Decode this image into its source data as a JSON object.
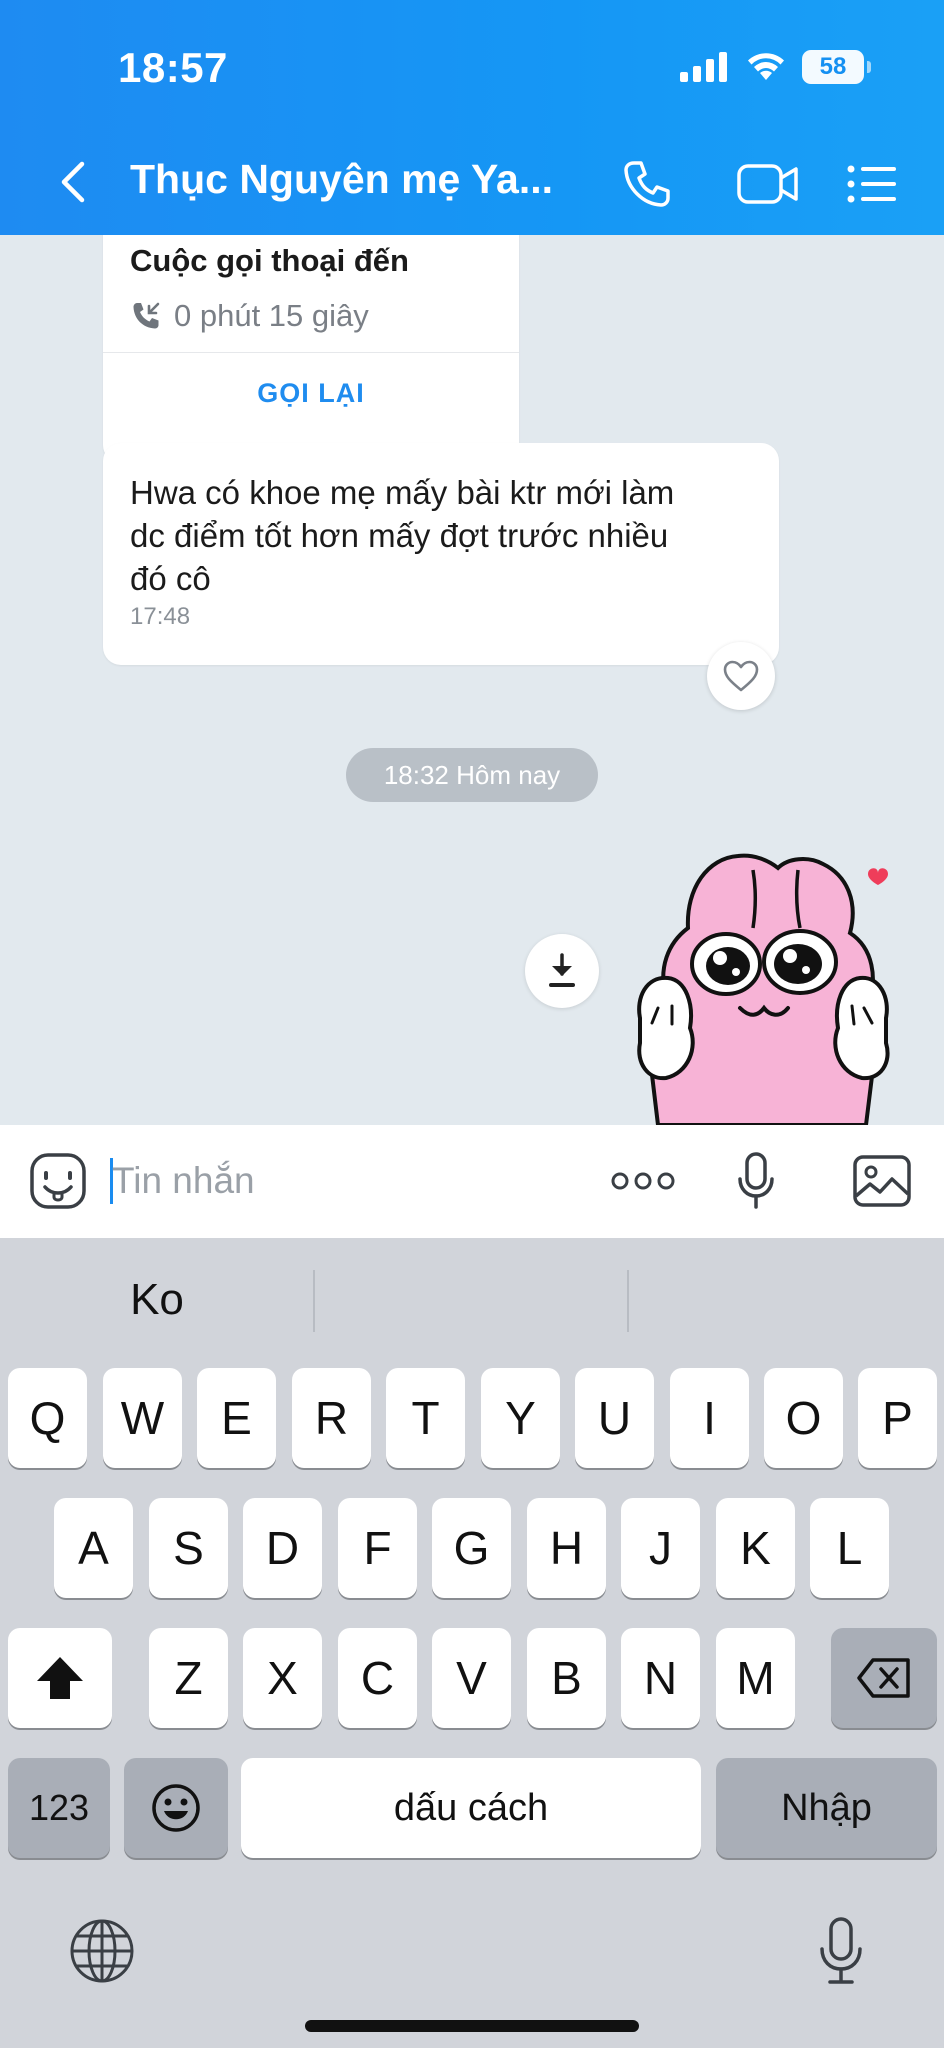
{
  "status_bar": {
    "time": "18:57",
    "battery": "58"
  },
  "header": {
    "title": "Thục Nguyên mẹ Ya..."
  },
  "chat": {
    "call_card": {
      "title": "Cuộc gọi thoại đến",
      "duration": "0 phút 15 giây",
      "recall_label": "GỌI LẠI"
    },
    "message": {
      "lines": [
        "Hwa có khoe mẹ mấy bài ktr mới làm",
        "dc điểm tốt hơn mấy đợt trước nhiều",
        "đó cô"
      ],
      "time": "17:48"
    },
    "date_separator": "18:32 Hôm nay"
  },
  "input": {
    "placeholder": "Tin nhắn"
  },
  "keyboard": {
    "suggestions": [
      "Ko",
      "",
      ""
    ],
    "row1": [
      "Q",
      "W",
      "E",
      "R",
      "T",
      "Y",
      "U",
      "I",
      "O",
      "P"
    ],
    "row2": [
      "A",
      "S",
      "D",
      "F",
      "G",
      "H",
      "J",
      "K",
      "L"
    ],
    "row3": [
      "Z",
      "X",
      "C",
      "V",
      "B",
      "N",
      "M"
    ],
    "numbers_label": "123",
    "space_label": "dấu cách",
    "return_label": "Nhập"
  },
  "colors": {
    "header": "#1e8bf2",
    "accent": "#1f8cef",
    "chat_bg": "#e2e9ee",
    "sticker_pink": "#f7b3d6"
  },
  "icons": [
    "back-chevron-icon",
    "phone-icon",
    "video-camera-icon",
    "menu-list-icon",
    "heart-icon",
    "download-icon",
    "emoji-icon",
    "more-dots-icon",
    "microphone-icon",
    "image-icon",
    "shift-icon",
    "backspace-icon",
    "globe-icon",
    "dictation-icon"
  ]
}
